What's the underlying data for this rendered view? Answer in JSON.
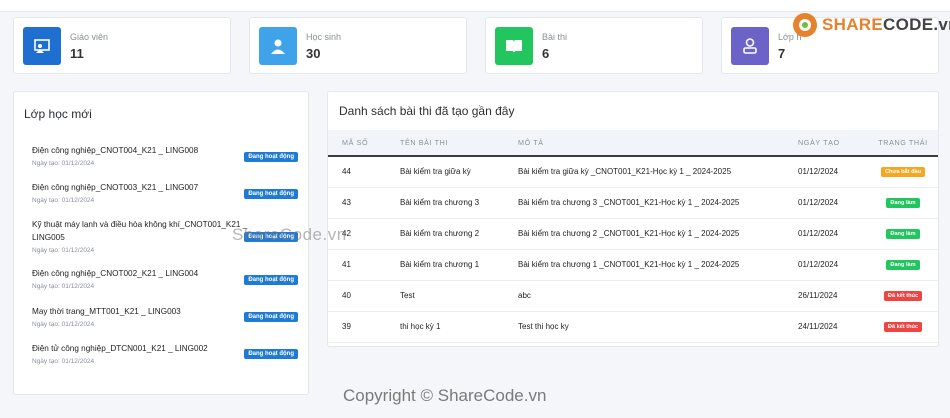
{
  "stats": [
    {
      "label": "Giáo viên",
      "value": "11",
      "color": "#1f6fd1",
      "icon": "teacher-icon"
    },
    {
      "label": "Học sinh",
      "value": "30",
      "color": "#3ea3e8",
      "icon": "student-icon"
    },
    {
      "label": "Bài thi",
      "value": "6",
      "color": "#22c55e",
      "icon": "book-icon"
    },
    {
      "label": "Lớp h",
      "value": "7",
      "color": "#6c63c9",
      "icon": "user-icon"
    }
  ],
  "classes": {
    "title": "Lớp học mới",
    "items": [
      {
        "name": "Điện công nghiệp_CNOT004_K21 _ LING008",
        "date": "Ngày tạo: 01/12/2024",
        "status": "Đang hoạt động"
      },
      {
        "name": "Điện công nghiệp_CNOT003_K21 _ LING007",
        "date": "Ngày tạo: 01/12/2024",
        "status": "Đang hoạt động"
      },
      {
        "name": "Kỹ thuật máy lạnh và điều hòa không khí_CNOT001_K21 _ LING005",
        "date": "Ngày tạo: 01/12/2024",
        "status": "Đang hoạt động"
      },
      {
        "name": "Điện công nghiệp_CNOT002_K21 _ LING004",
        "date": "Ngày tạo: 01/12/2024",
        "status": "Đang hoạt động"
      },
      {
        "name": "May thời trang_MTT001_K21 _ LING003",
        "date": "Ngày tạo: 01/12/2024",
        "status": "Đang hoạt động"
      },
      {
        "name": "Điện tử công nghiệp_DTCN001_K21 _ LING002",
        "date": "Ngày tạo: 01/12/2024",
        "status": "Đang hoạt động"
      }
    ]
  },
  "exams": {
    "title": "Danh sách bài thi đã tạo gần đây",
    "headers": [
      "MÃ SỐ",
      "TÊN BÀI THI",
      "MÔ TẢ",
      "NGÀY TẠO",
      "TRẠNG THÁI"
    ],
    "rows": [
      {
        "id": "44",
        "name": "Bài kiểm tra giữa kỳ",
        "desc": "Bài kiểm tra giữa kỳ _CNOT001_K21-Học kỳ 1 _ 2024-2025",
        "date": "01/12/2024",
        "status": "Chưa bắt đầu",
        "status_color": "#f5a623"
      },
      {
        "id": "43",
        "name": "Bài kiểm tra chương 3",
        "desc": "Bài kiểm tra chương 3 _CNOT001_K21-Học kỳ 1 _ 2024-2025",
        "date": "01/12/2024",
        "status": "Đang làm",
        "status_color": "#22c55e"
      },
      {
        "id": "42",
        "name": "Bài kiểm tra chương 2",
        "desc": "Bài kiểm tra chương 2 _CNOT001_K21-Học kỳ 1 _ 2024-2025",
        "date": "01/12/2024",
        "status": "Đang làm",
        "status_color": "#22c55e"
      },
      {
        "id": "41",
        "name": "Bài kiểm tra chương 1",
        "desc": "Bài kiểm tra chương 1 _CNOT001_K21-Học kỳ 1 _ 2024-2025",
        "date": "01/12/2024",
        "status": "Đang làm",
        "status_color": "#22c55e"
      },
      {
        "id": "40",
        "name": "Test",
        "desc": "abc",
        "date": "26/11/2024",
        "status": "Đã kết thúc",
        "status_color": "#ef4444"
      },
      {
        "id": "39",
        "name": "thi học kỳ 1",
        "desc": "Test thi học ky",
        "date": "24/11/2024",
        "status": "Đã kết thúc",
        "status_color": "#ef4444"
      }
    ]
  },
  "overlay": {
    "watermark": "ShareCode.vn",
    "copyright": "Copyright © ShareCode.vn",
    "logo_brand": "SHARE",
    "logo_rest": "CODE.vn"
  }
}
